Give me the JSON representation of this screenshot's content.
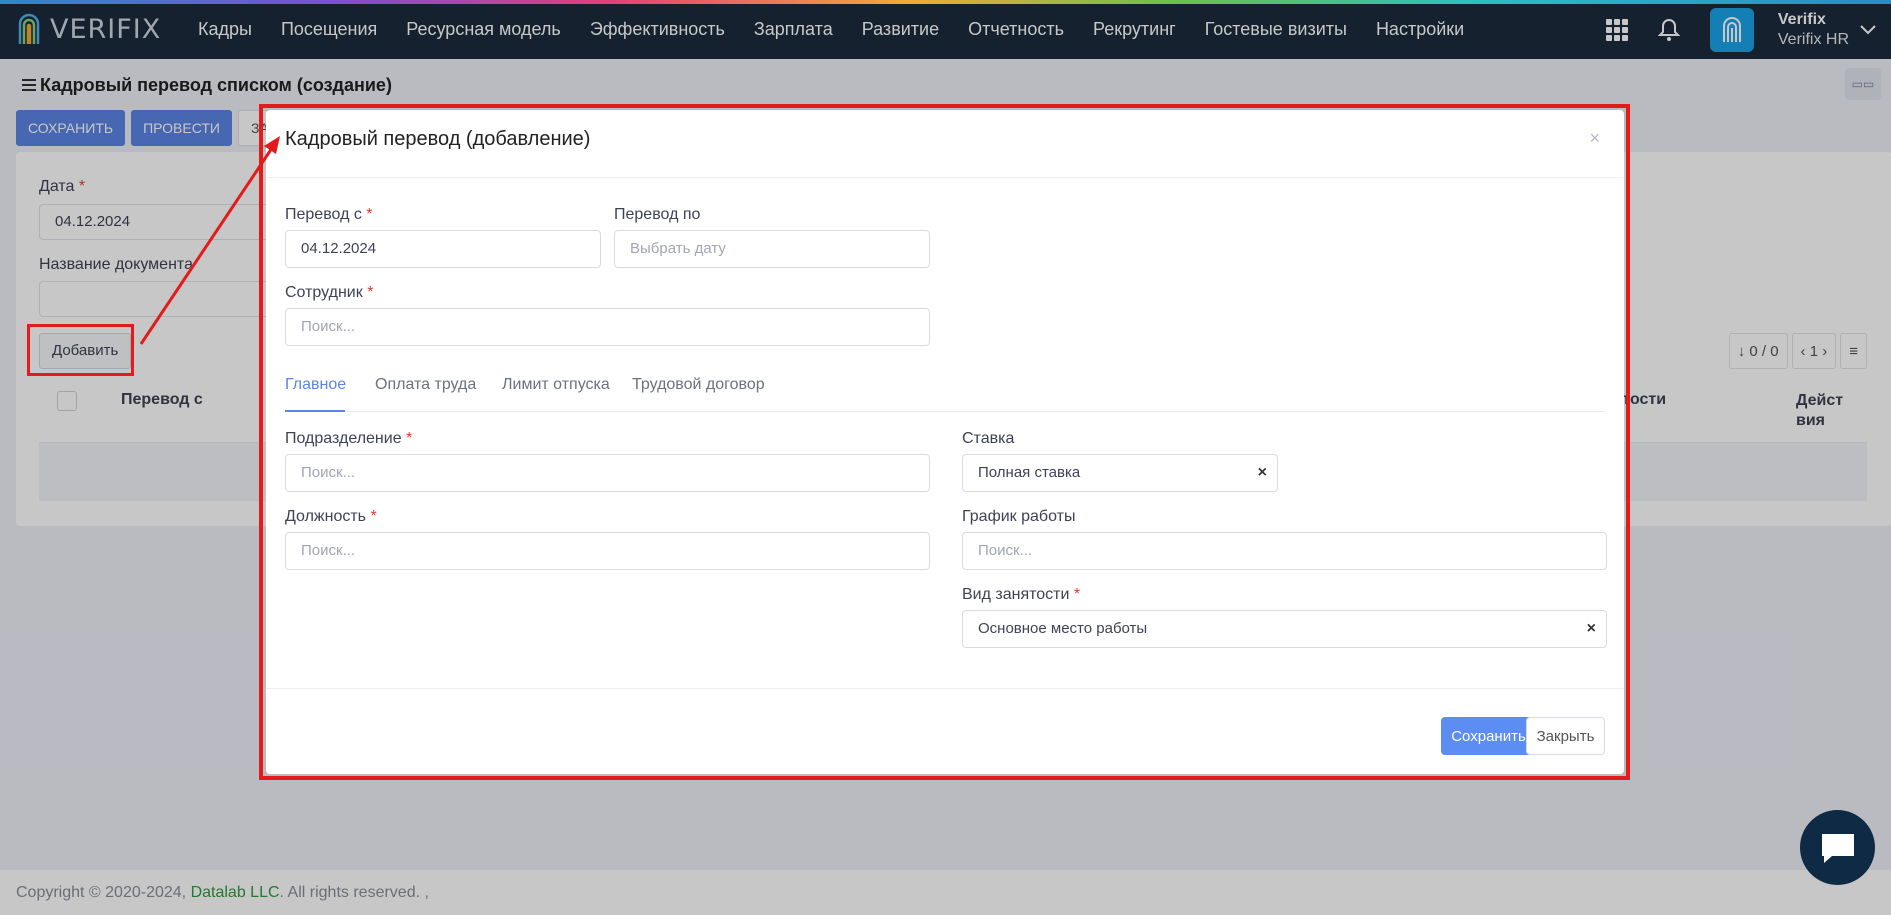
{
  "brand": {
    "logo_text": "VERIFIX"
  },
  "nav": {
    "items": [
      "Кадры",
      "Посещения",
      "Ресурсная модель",
      "Эффективность",
      "Зарплата",
      "Развитие",
      "Отчетность",
      "Рекрутинг",
      "Гостевые визиты",
      "Настройки"
    ]
  },
  "user": {
    "name": "Verifix",
    "company": "Verifix HR"
  },
  "page": {
    "title": "Кадровый перевод списком (создание)"
  },
  "toolbar": {
    "save_label": "СОХРАНИТЬ",
    "post_label": "ПРОВЕСТИ",
    "third_label": "ЗАК"
  },
  "background_form": {
    "date_label": "Дата",
    "date_value": "04.12.2024",
    "doc_name_label": "Название документа",
    "add_button": "Добавить",
    "col_transfer_from": "Перевод с",
    "col_employment": "ятости",
    "col_actions": "Дейст вия",
    "pager_count": "0 / 0",
    "pager_page": "1"
  },
  "modal": {
    "title": "Кадровый перевод (добавление)",
    "close_symbol": "×",
    "transfer_from_label": "Перевод с",
    "transfer_from_value": "04.12.2024",
    "transfer_to_label": "Перевод по",
    "transfer_to_placeholder": "Выбрать дату",
    "employee_label": "Сотрудник",
    "search_placeholder": "Поиск...",
    "tabs": [
      "Главное",
      "Оплата труда",
      "Лимит отпуска",
      "Трудовой договор"
    ],
    "division_label": "Подразделение",
    "position_label": "Должность",
    "rate_label": "Ставка",
    "rate_value": "Полная ставка",
    "schedule_label": "График работы",
    "employment_type_label": "Вид занятости",
    "employment_type_value": "Основное место работы",
    "clear_symbol": "×",
    "save_button": "Сохранить",
    "close_button": "Закрыть"
  },
  "footer": {
    "copyright": "Copyright © 2020-2024,",
    "company": "Datalab LLC",
    "rights": ". All rights reserved. ,"
  },
  "required_mark": "*",
  "colors": {
    "navbar": "#1b2b3c",
    "primary": "#5b84e6",
    "highlight": "#e21b1b",
    "link": "#2e9b3e"
  }
}
